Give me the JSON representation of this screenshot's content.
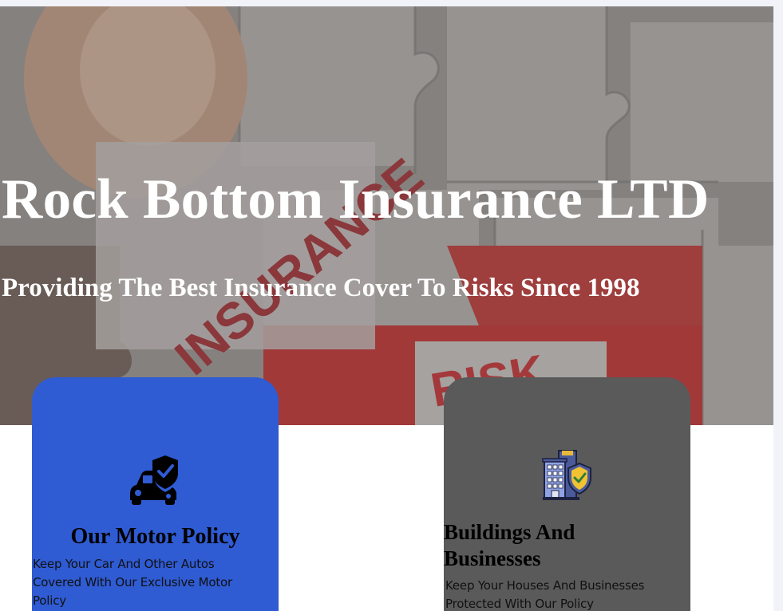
{
  "hero": {
    "title": "Rock Bottom Insurance LTD",
    "subtitle": "Providing The Best Insurance Cover To Risks Since 1998",
    "photo_words": [
      "INSURANCE",
      "RISK"
    ]
  },
  "cards": [
    {
      "title": "Our Motor Policy",
      "description": "Keep Your Car And Other Autos Covered With Our Exclusive Motor Policy",
      "icon": "car-shield-icon",
      "color": "#2f5bd3"
    },
    {
      "title": "Buildings And Businesses",
      "description": "Keep Your Houses And Businesses Protected With Our Policy",
      "icon": "building-shield-icon",
      "color": "#5a5a5a"
    }
  ]
}
